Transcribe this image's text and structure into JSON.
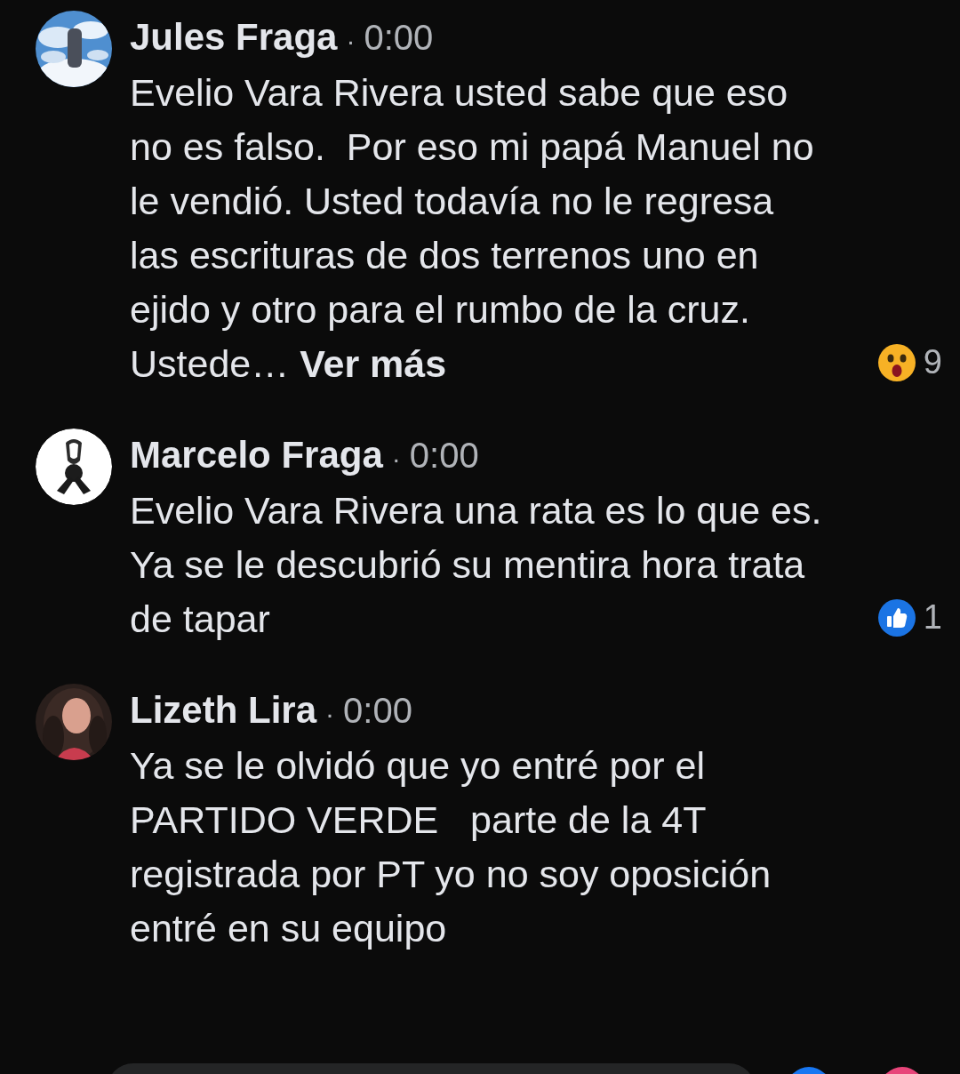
{
  "comments": [
    {
      "author": "Jules Fraga",
      "separator": "·",
      "time": "0:00",
      "text": "Evelio Vara Rivera usted sabe que eso no es falso.  Por eso mi papá Manuel no le vendió. Usted todavía no le regresa las escrituras de dos terrenos uno en ejido y otro para el rumbo de la cruz. Ustede… **Ver más**",
      "reaction": {
        "kind": "wow",
        "count": "9"
      }
    },
    {
      "author": "Marcelo Fraga",
      "separator": "·",
      "time": "0:00",
      "avatar": {
        "kind": "ribbon"
      },
      "text": "Evelio Vara Rivera una rata es lo que es. Ya se le descubrió su mentira hora trata de tapar",
      "reaction": {
        "kind": "like",
        "count": "1"
      }
    },
    {
      "author": "Lizeth Lira",
      "separator": "·",
      "time": "0:00",
      "text": "Ya se le olvidó que yo entré por el PARTIDO VERDE   parte de la 4T registrada por PT yo no soy oposición entré en su equipo"
    }
  ]
}
